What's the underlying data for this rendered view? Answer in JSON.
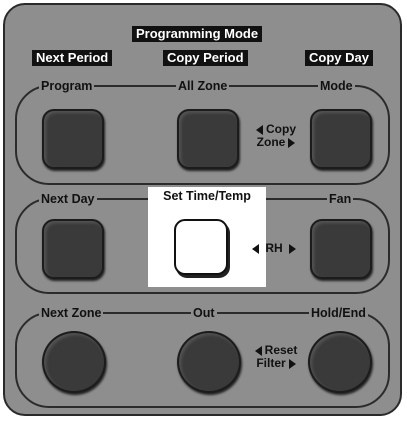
{
  "header": {
    "programming_mode": "Programming Mode",
    "next_period": "Next Period",
    "copy_period": "Copy Period",
    "copy_day": "Copy Day"
  },
  "row1": {
    "program": "Program",
    "all_zone": "All Zone",
    "mode": "Mode",
    "copy_top": "Copy",
    "copy_bottom": "Zone"
  },
  "row2": {
    "next_day": "Next Day",
    "set_time_temp": "Set Time/Temp",
    "fan": "Fan",
    "rh": "RH"
  },
  "row3": {
    "next_zone": "Next Zone",
    "out": "Out",
    "hold_end": "Hold/End",
    "reset_top": "Reset",
    "reset_bottom": "Filter"
  },
  "colors": {
    "panel": "#8e8e8e",
    "button": "#3a3a3a",
    "header_band": "#111111",
    "highlight": "#ffffff"
  }
}
